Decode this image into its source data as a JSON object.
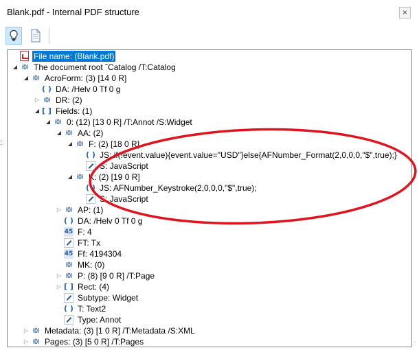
{
  "window": {
    "title": "Blank.pdf - Internal PDF structure",
    "close_glyph": "×"
  },
  "toolbar": {
    "buttons": [
      {
        "name": "bulb-button",
        "icon": "lightbulb-icon"
      },
      {
        "name": "document-button",
        "icon": "document-icon"
      }
    ]
  },
  "tree": [
    {
      "level": 0,
      "expander": "none",
      "icon": "pdf",
      "text": "File name: (Blank.pdf)",
      "selected": true
    },
    {
      "level": 0,
      "expander": "expanded",
      "icon": "dict",
      "text": "The document root ˆCatalog       /T:Catalog"
    },
    {
      "level": 1,
      "expander": "expanded",
      "icon": "dict",
      "text": "AcroForm:   (3) [14 0 R]"
    },
    {
      "level": 2,
      "expander": "none",
      "icon": "str",
      "text": "DA:   /Helv 0 Tf 0 g"
    },
    {
      "level": 2,
      "expander": "collapsed",
      "icon": "dict",
      "text": "DR:   (2)"
    },
    {
      "level": 2,
      "expander": "expanded",
      "icon": "arr",
      "text": "Fields:   (1)"
    },
    {
      "level": 3,
      "expander": "expanded",
      "icon": "dict",
      "text": "0:   (12) [13 0 R]        /T:Annot  /S:Widget"
    },
    {
      "level": 4,
      "expander": "expanded",
      "icon": "dict",
      "text": "AA:   (2)"
    },
    {
      "level": 5,
      "expander": "expanded",
      "icon": "dict",
      "text": "F:   (2) [18 0 R]"
    },
    {
      "level": 6,
      "expander": "none",
      "icon": "str",
      "text": "JS:   if(!event.value){event.value=\"USD\"}else{AFNumber_Format(2,0,0,0,\"$\",true);}"
    },
    {
      "level": 6,
      "expander": "none",
      "icon": "name",
      "text": "S:   JavaScript"
    },
    {
      "level": 5,
      "expander": "expanded",
      "icon": "dict",
      "text": "K:   (2) [19 0 R]"
    },
    {
      "level": 6,
      "expander": "none",
      "icon": "str",
      "text": "JS:   AFNumber_Keystroke(2,0,0,0,\"$\",true);"
    },
    {
      "level": 6,
      "expander": "none",
      "icon": "name",
      "text": "S:   JavaScript"
    },
    {
      "level": 4,
      "expander": "collapsed",
      "icon": "dict",
      "text": "AP:   (1)"
    },
    {
      "level": 4,
      "expander": "none",
      "icon": "str",
      "text": "DA:   /Helv 0 Tf 0 g"
    },
    {
      "level": 4,
      "expander": "none",
      "icon": "num",
      "text": "F:   4"
    },
    {
      "level": 4,
      "expander": "none",
      "icon": "name",
      "text": "FT:   Tx"
    },
    {
      "level": 4,
      "expander": "none",
      "icon": "num",
      "text": "Ff:   4194304"
    },
    {
      "level": 4,
      "expander": "none",
      "icon": "dict",
      "text": "MK:   (0)"
    },
    {
      "level": 4,
      "expander": "collapsed",
      "icon": "dict",
      "text": "P:   (8) [9 0 R]        /T:Page"
    },
    {
      "level": 4,
      "expander": "collapsed",
      "icon": "arr",
      "text": "Rect:   (4)"
    },
    {
      "level": 4,
      "expander": "none",
      "icon": "name",
      "text": "Subtype:   Widget"
    },
    {
      "level": 4,
      "expander": "none",
      "icon": "str",
      "text": "T:   Text2"
    },
    {
      "level": 4,
      "expander": "none",
      "icon": "name",
      "text": "Type:   Annot"
    },
    {
      "level": 1,
      "expander": "collapsed",
      "icon": "dict",
      "text": "Metadata:   (3) [1 0 R]        /T:Metadata  /S:XML"
    },
    {
      "level": 1,
      "expander": "collapsed",
      "icon": "dict",
      "text": "Pages:   (3) [5 0 R]        /T:Pages"
    }
  ],
  "colors": {
    "selection": "#0078d7",
    "annotation_ellipse": "#e0141e",
    "icon_blue": "#1f63b6"
  }
}
